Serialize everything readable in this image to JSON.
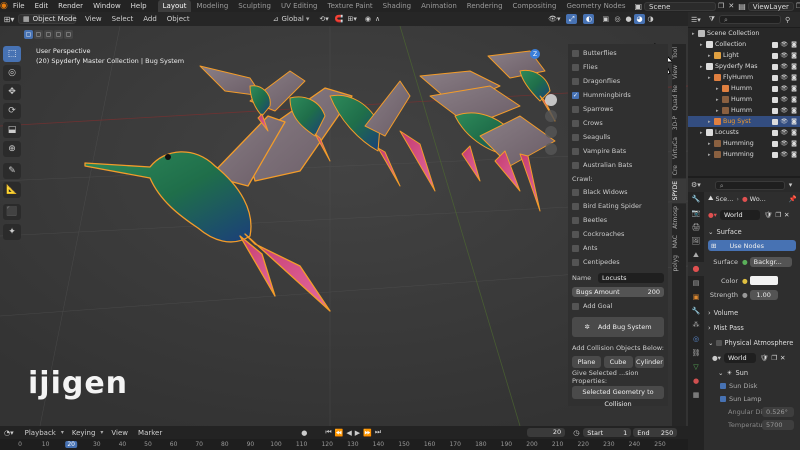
{
  "menu": [
    "File",
    "Edit",
    "Render",
    "Window",
    "Help"
  ],
  "workspaces": [
    "Layout",
    "Modeling",
    "Sculpting",
    "UV Editing",
    "Texture Paint",
    "Shading",
    "Animation",
    "Rendering",
    "Compositing",
    "Geometry Nodes"
  ],
  "active_workspace": "Layout",
  "scene_name": "Scene",
  "view_layer": "ViewLayer",
  "viewport_header": {
    "mode": "Object Mode",
    "menus": [
      "View",
      "Select",
      "Add",
      "Object"
    ],
    "orientation": "Global"
  },
  "viewport_info": {
    "line1": "User Perspective",
    "line2": "(20) Spyderfy Master Collection | Bug System"
  },
  "logo_text": "ijigen",
  "n_tabs": [
    "Tool",
    "View",
    "Quad Re",
    "3D-P",
    "VirtuCa",
    "Cre",
    "SPYDE",
    "Atmosp",
    "MAC",
    "polyg"
  ],
  "addon": {
    "fly_items": [
      {
        "label": "Butterflies",
        "checked": false
      },
      {
        "label": "Flies",
        "checked": false
      },
      {
        "label": "Dragonflies",
        "checked": false
      },
      {
        "label": "Hummingbirds",
        "checked": true
      },
      {
        "label": "Sparrows",
        "checked": false
      },
      {
        "label": "Crows",
        "checked": false
      },
      {
        "label": "Seagulls",
        "checked": false
      },
      {
        "label": "Vampire Bats",
        "checked": false
      },
      {
        "label": "Australian Bats",
        "checked": false
      }
    ],
    "crawl_label": "Crawl:",
    "crawl_items": [
      {
        "label": "Black Widows",
        "checked": false
      },
      {
        "label": "Bird Eating Spider",
        "checked": false
      },
      {
        "label": "Beetles",
        "checked": false
      },
      {
        "label": "Cockroaches",
        "checked": false
      },
      {
        "label": "Ants",
        "checked": false
      },
      {
        "label": "Centipedes",
        "checked": false
      }
    ],
    "name_label": "Name",
    "name_value": "Locusts",
    "amount_label": "Bugs Amount",
    "amount_value": "200",
    "add_goal": "Add Goal",
    "add_bug_system": "Add Bug System",
    "collision_label": "Add Collision Objects Below:",
    "collision_buttons": [
      "Plane",
      "Cube",
      "Cylinder"
    ],
    "give_selected": "Give Selected ...sion Properties:",
    "selected_geometry": "Selected Geometry to Collision"
  },
  "outliner": {
    "rows": [
      {
        "label": "Scene Collection",
        "indent": 0,
        "icon": "#bbbbbb",
        "selected": false,
        "vis": false
      },
      {
        "label": "Collection",
        "indent": 1,
        "icon": "#dddddd",
        "selected": false,
        "vis": true
      },
      {
        "label": "Light",
        "indent": 2,
        "icon": "#e0a040",
        "selected": false,
        "vis": true
      },
      {
        "label": "Spyderfy Mas",
        "indent": 1,
        "icon": "#dddddd",
        "selected": false,
        "vis": true
      },
      {
        "label": "FlyHumm",
        "indent": 2,
        "icon": "#e08040",
        "selected": false,
        "vis": true
      },
      {
        "label": "Humm",
        "indent": 3,
        "icon": "#e08040",
        "selected": false,
        "vis": true
      },
      {
        "label": "Humm",
        "indent": 3,
        "icon": "#8a6040",
        "selected": false,
        "vis": true
      },
      {
        "label": "Humm",
        "indent": 3,
        "icon": "#8a6040",
        "selected": false,
        "vis": true
      },
      {
        "label": "Bug Syst",
        "indent": 2,
        "icon": "#e08040",
        "selected": true,
        "vis": true
      },
      {
        "label": "Locusts",
        "indent": 1,
        "icon": "#dddddd",
        "selected": false,
        "vis": true
      },
      {
        "label": "Humming",
        "indent": 2,
        "icon": "#8a6040",
        "selected": false,
        "vis": true
      },
      {
        "label": "Humming",
        "indent": 2,
        "icon": "#8a6040",
        "selected": false,
        "vis": true
      }
    ]
  },
  "properties": {
    "breadcrumb_scene": "Sce...",
    "breadcrumb_world": "Wo...",
    "world_name": "World",
    "surface_section": "Surface",
    "use_nodes": "Use Nodes",
    "surface_label": "Surface",
    "surface_value": "Backgr...",
    "color_label": "Color",
    "strength_label": "Strength",
    "strength_value": "1.00",
    "volume_section": "Volume",
    "mist_section": "Mist Pass",
    "phys_section": "Physical Atmosphere",
    "phys_world": "World",
    "sun_section": "Sun",
    "sun_disk": "Sun Disk",
    "sun_lamp": "Sun Lamp",
    "angular": "Angular Di",
    "angular_value": "0.526°",
    "temperature": "Temperature",
    "temperature_value": "5700"
  },
  "timeline": {
    "menus": [
      "Playback",
      "Keying",
      "View",
      "Marker"
    ],
    "current_frame": "20",
    "start_label": "Start",
    "start_value": "1",
    "end_label": "End",
    "end_value": "250",
    "ruler": [
      "0",
      "10",
      "20",
      "30",
      "40",
      "50",
      "60",
      "70",
      "80",
      "90",
      "100",
      "110",
      "120",
      "130",
      "140",
      "150",
      "160",
      "170",
      "180",
      "190",
      "200",
      "210",
      "220",
      "230",
      "240",
      "250"
    ],
    "ruler_current": "20"
  },
  "colors": {
    "accent": "#4772b3",
    "selected_outline": "#f39c2a",
    "viewport_bg": "#3a3a3a"
  }
}
